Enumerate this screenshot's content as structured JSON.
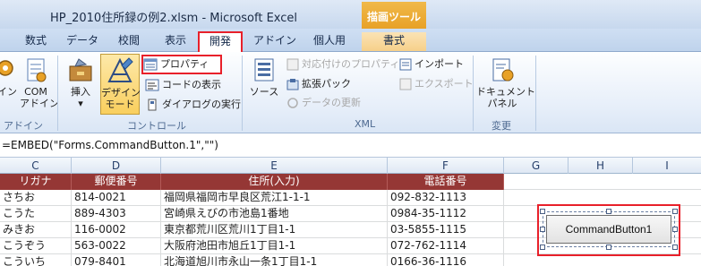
{
  "window": {
    "title": "HP_2010住所録の例2.xlsm - Microsoft Excel",
    "context_tab": "描画ツール"
  },
  "tabs": [
    {
      "label": "数式"
    },
    {
      "label": "データ"
    },
    {
      "label": "校閲"
    },
    {
      "label": "表示"
    },
    {
      "label": "開発"
    },
    {
      "label": "アドイン"
    },
    {
      "label": "個人用"
    },
    {
      "label": "書式"
    }
  ],
  "ribbon": {
    "addins": {
      "partial_label": "イン",
      "com_label_1": "COM",
      "com_label_2": "アドイン",
      "group_label": "アドイン"
    },
    "controls": {
      "insert_label": "挿入",
      "design_label_1": "デザイン",
      "design_label_2": "モード",
      "properties": "プロパティ",
      "view_code": "コードの表示",
      "run_dialog": "ダイアログの実行",
      "group_label": "コントロール"
    },
    "xml": {
      "source_label": "ソース",
      "map_props": "対応付けのプロパティ",
      "expansion": "拡張パック",
      "refresh": "データの更新",
      "import": "インポート",
      "export": "エクスポート",
      "group_label": "XML"
    },
    "modify": {
      "doc_panel_1": "ドキュメント",
      "doc_panel_2": "パネル",
      "group_label": "変更"
    }
  },
  "formula_bar": {
    "formula": "=EMBED(\"Forms.CommandButton.1\",\"\")"
  },
  "columns": [
    "C",
    "D",
    "E",
    "F",
    "G",
    "H",
    "I"
  ],
  "table": {
    "headers": [
      "リガナ",
      "郵便番号",
      "住所(入力)",
      "電話番号"
    ],
    "rows": [
      [
        "さちお",
        "814-0021",
        "福岡県福岡市早良区荒江1-1-1",
        "092-832-1113"
      ],
      [
        "こうた",
        "889-4303",
        "宮崎県えびの市池島1番地",
        "0984-35-1112"
      ],
      [
        "みきお",
        "116-0002",
        "東京都荒川区荒川1丁目1-1",
        "03-5855-1115"
      ],
      [
        "こうぞう",
        "563-0022",
        "大阪府池田市旭丘1丁目1-1",
        "072-762-1114"
      ],
      [
        "こういち",
        "079-8401",
        "北海道旭川市永山一条1丁目1-1",
        "0166-36-1116"
      ]
    ]
  },
  "command_button": {
    "caption": "CommandButton1"
  }
}
